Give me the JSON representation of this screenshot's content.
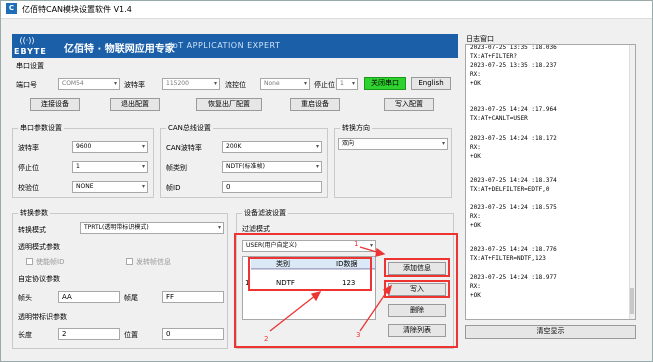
{
  "window": {
    "title": "亿佰特CAN模块设置软件 V1.4"
  },
  "banner": {
    "logo_text": "EBYTE",
    "slogan_cn": "亿佰特 · 物联网应用专家",
    "slogan_en": "IoT APPLICATION EXPERT"
  },
  "serial_settings": {
    "group_title": "串口设置",
    "port_label": "端口号",
    "port_value": "COM54",
    "baud_label": "波特率",
    "baud_value": "115200",
    "flow_label": "流控位",
    "flow_value": "None",
    "stop_label": "停止位",
    "stop_value": "1",
    "close_button": "关闭串口",
    "lang_button": "English"
  },
  "toolbar": {
    "connect": "连接设备",
    "exit_config": "退出配置",
    "factory_reset": "恢复出厂配置",
    "restart": "重启设备",
    "write_config": "写入配置"
  },
  "uart_params": {
    "title": "串口参数设置",
    "baud_label": "波特率",
    "baud_value": "9600",
    "stop_label": "停止位",
    "stop_value": "1",
    "parity_label": "校验位",
    "parity_value": "NONE"
  },
  "can_params": {
    "title": "CAN总线设置",
    "baud_label": "CAN波特率",
    "baud_value": "200K",
    "frame_label": "帧类别",
    "frame_value": "NDTF(标准帧)",
    "id_label": "帧ID",
    "id_value": "0"
  },
  "direction": {
    "title": "转换方向",
    "value": "双向"
  },
  "transfer": {
    "title": "转换参数",
    "mode_label": "转换模式",
    "mode_value": "TPRTL(透明带标识模式)",
    "transparent_title": "透明模式参数",
    "check_frame_info": "使能帧ID",
    "check_frame_info2": "发转帧信息",
    "custom_title": "自定协议参数",
    "head_label": "帧头",
    "head_value": "AA",
    "tail_label": "帧尾",
    "tail_value": "FF",
    "tag_title": "透明带标识参数",
    "len_label": "长度",
    "len_value": "2",
    "pos_label": "位置",
    "pos_value": "0"
  },
  "device_filter": {
    "title": "设备滤波设置",
    "sub_title": "过滤模式",
    "mode_value": "USER(用户自定义)",
    "col_type": "类别",
    "col_id": "ID数据",
    "row_index": "1",
    "row_type": "NDTF",
    "row_id": "123",
    "add_button": "添加信息",
    "write_button": "写入",
    "delete_button": "删除",
    "clear_button": "清除列表"
  },
  "annotations": {
    "a1": "1",
    "a2": "2",
    "a3": "3"
  },
  "log": {
    "title": "日志窗口",
    "lines": [
      "2023-07-25 13:35 :18.036",
      "TX:AT+FILTER?",
      "2023-07-25 13:35 :18.237",
      "RX:",
      "+OK",
      "2023-07-25 14:24 :17.964",
      "TX:AT+CANLT=USER",
      "2023-07-25 14:24 :18.172",
      "RX:",
      "+OK",
      "2023-07-25 14:24 :18.374",
      "TX:AT+DELFILTER=EDTF,0",
      "2023-07-25 14:24 :18.575",
      "RX:",
      "+OK",
      "2023-07-25 14:24 :18.776",
      "TX:AT+FILTER=NDTF,123",
      "2023-07-25 14:24 :18.977",
      "RX:",
      "+OK"
    ],
    "clear_button": "清空显示"
  },
  "colors": {
    "banner": "#1a5fa8",
    "green_button": "#2ed12e",
    "annotation": "#e33333"
  }
}
